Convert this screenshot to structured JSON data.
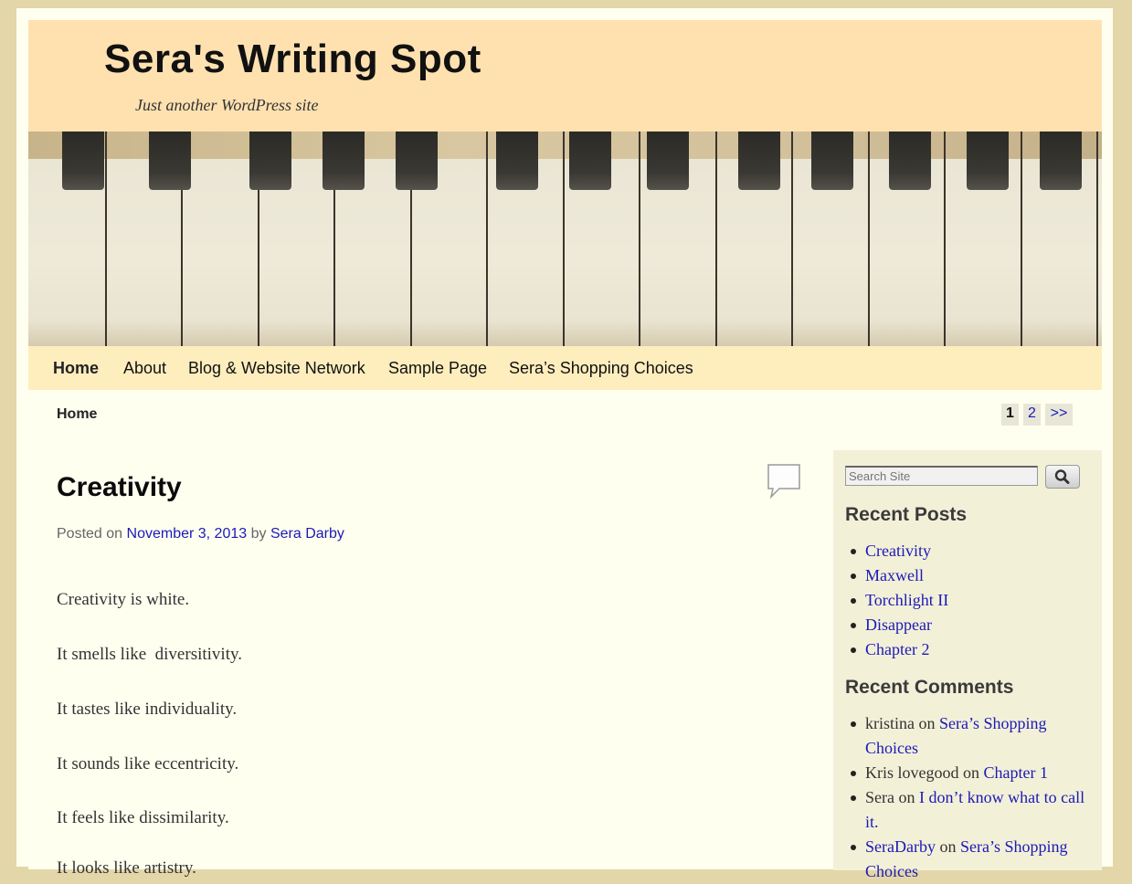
{
  "site": {
    "title": "Sera's Writing Spot",
    "tagline": "Just another WordPress site"
  },
  "nav": {
    "items": [
      {
        "label": "Home"
      },
      {
        "label": "About"
      },
      {
        "label": "Blog & Website Network"
      },
      {
        "label": "Sample Page"
      },
      {
        "label": "Sera’s Shopping Choices"
      }
    ]
  },
  "breadcrumb": "Home",
  "pagination": {
    "current": "1",
    "next_page": "2",
    "next": ">>"
  },
  "post": {
    "title": "Creativity",
    "meta_posted_on": "Posted on",
    "date": "November 3, 2013",
    "meta_by": "by",
    "author": "Sera Darby",
    "paragraphs": [
      "Creativity is white.",
      "It smells like  diversitivity.",
      "It tastes like individuality.",
      "It sounds like eccentricity.",
      "It feels like dissimilarity.",
      "It looks like artistry."
    ]
  },
  "sidebar": {
    "search_placeholder": "Search Site",
    "recent_posts_title": "Recent Posts",
    "recent_posts": [
      "Creativity",
      "Maxwell",
      "Torchlight II",
      "Disappear",
      "Chapter 2"
    ],
    "recent_comments_title": "Recent Comments",
    "recent_comments": [
      {
        "author": "kristina",
        "on": "on",
        "post": "Sera’s Shopping Choices"
      },
      {
        "author": "Kris lovegood",
        "on": "on",
        "post": "Chapter 1"
      },
      {
        "author": "Sera",
        "on": "on",
        "post": "I don’t know what to call it."
      },
      {
        "author": "SeraDarby",
        "on": "on",
        "post": "Sera’s Shopping Choices"
      }
    ]
  },
  "colors": {
    "background": "#e3d6a8",
    "header": "#ffe1b0",
    "nav": "#ffeebd",
    "content": "#fffff0",
    "sidebar": "#f3f0d8",
    "link": "#1a1ab8"
  },
  "icons": {
    "comment": "comment-bubble-icon",
    "search": "magnifier-icon"
  }
}
